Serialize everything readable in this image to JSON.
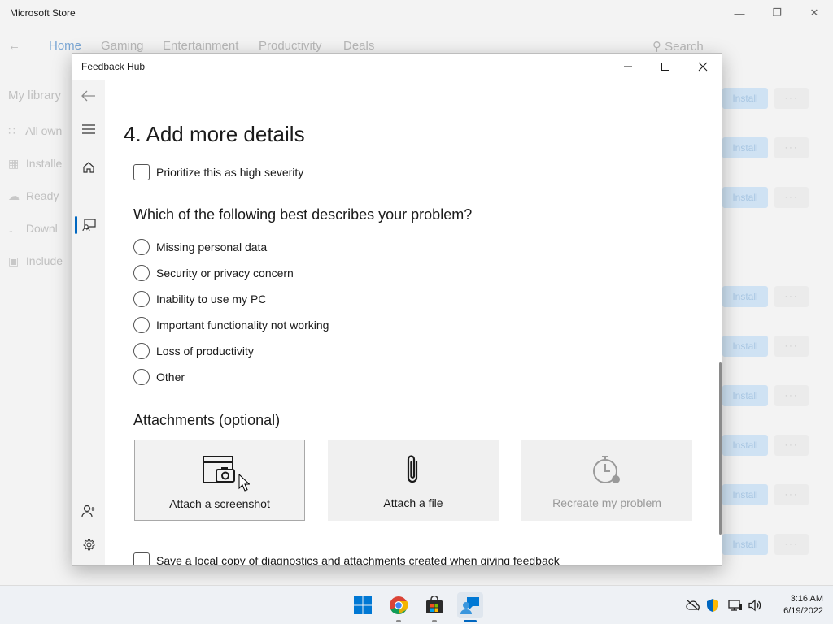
{
  "store": {
    "title": "Microsoft Store",
    "nav": [
      "Home",
      "Gaming",
      "Entertainment",
      "Productivity",
      "Deals"
    ],
    "search_label": "Search",
    "library_title": "My library",
    "side_items": [
      "All own",
      "Installe",
      "Ready",
      "Downl",
      "Include"
    ],
    "install_label": "Install"
  },
  "hub": {
    "title": "Feedback Hub",
    "heading": "4. Add more details",
    "high_severity_label": "Prioritize this as high severity",
    "question": "Which of the following best describes your problem?",
    "options": [
      "Missing personal data",
      "Security or privacy concern",
      "Inability to use my PC",
      "Important functionality not working",
      "Loss of productivity",
      "Other"
    ],
    "attachments_heading": "Attachments (optional)",
    "attach_screenshot": "Attach a screenshot",
    "attach_file": "Attach a file",
    "recreate_problem": "Recreate my problem",
    "save_local_copy_label": "Save a local copy of diagnostics and attachments created when giving feedback"
  },
  "taskbar": {
    "time": "3:16 AM",
    "date": "6/19/2022"
  }
}
